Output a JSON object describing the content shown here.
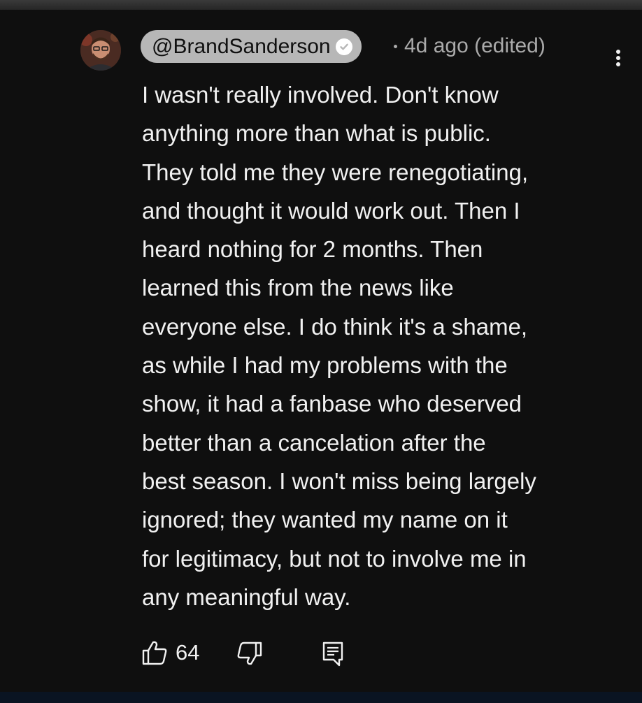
{
  "comment": {
    "author": "@BrandSanderson",
    "verified": true,
    "timestamp": "4d ago (edited)",
    "text_lines": [
      "I wasn't really involved. Don't know",
      "anything more than what is public.",
      "They told me they were renegotiating,",
      "and thought it would work out. Then I",
      "heard nothing for 2 months. Then",
      "learned this from the news like",
      "everyone else. I do think it's a shame,",
      "as while I had my problems with the",
      "show, it had a fanbase who deserved",
      "better than a cancelation after the",
      "best season. I won't miss being largely",
      "ignored; they wanted my name on it",
      "for legitimacy, but not to involve me in",
      "any meaningful way."
    ],
    "likes": "64"
  },
  "icons": {
    "avatar": "avatar-photo",
    "verified": "verified-check-icon",
    "more": "more-vertical-icon",
    "like": "thumb-up-icon",
    "dislike": "thumb-down-icon",
    "reply": "reply-comment-icon"
  },
  "colors": {
    "background": "#0f0f0f",
    "text": "#f1f1f1",
    "meta_text": "#aaaaaa",
    "author_chip": "#b7b7b7"
  }
}
